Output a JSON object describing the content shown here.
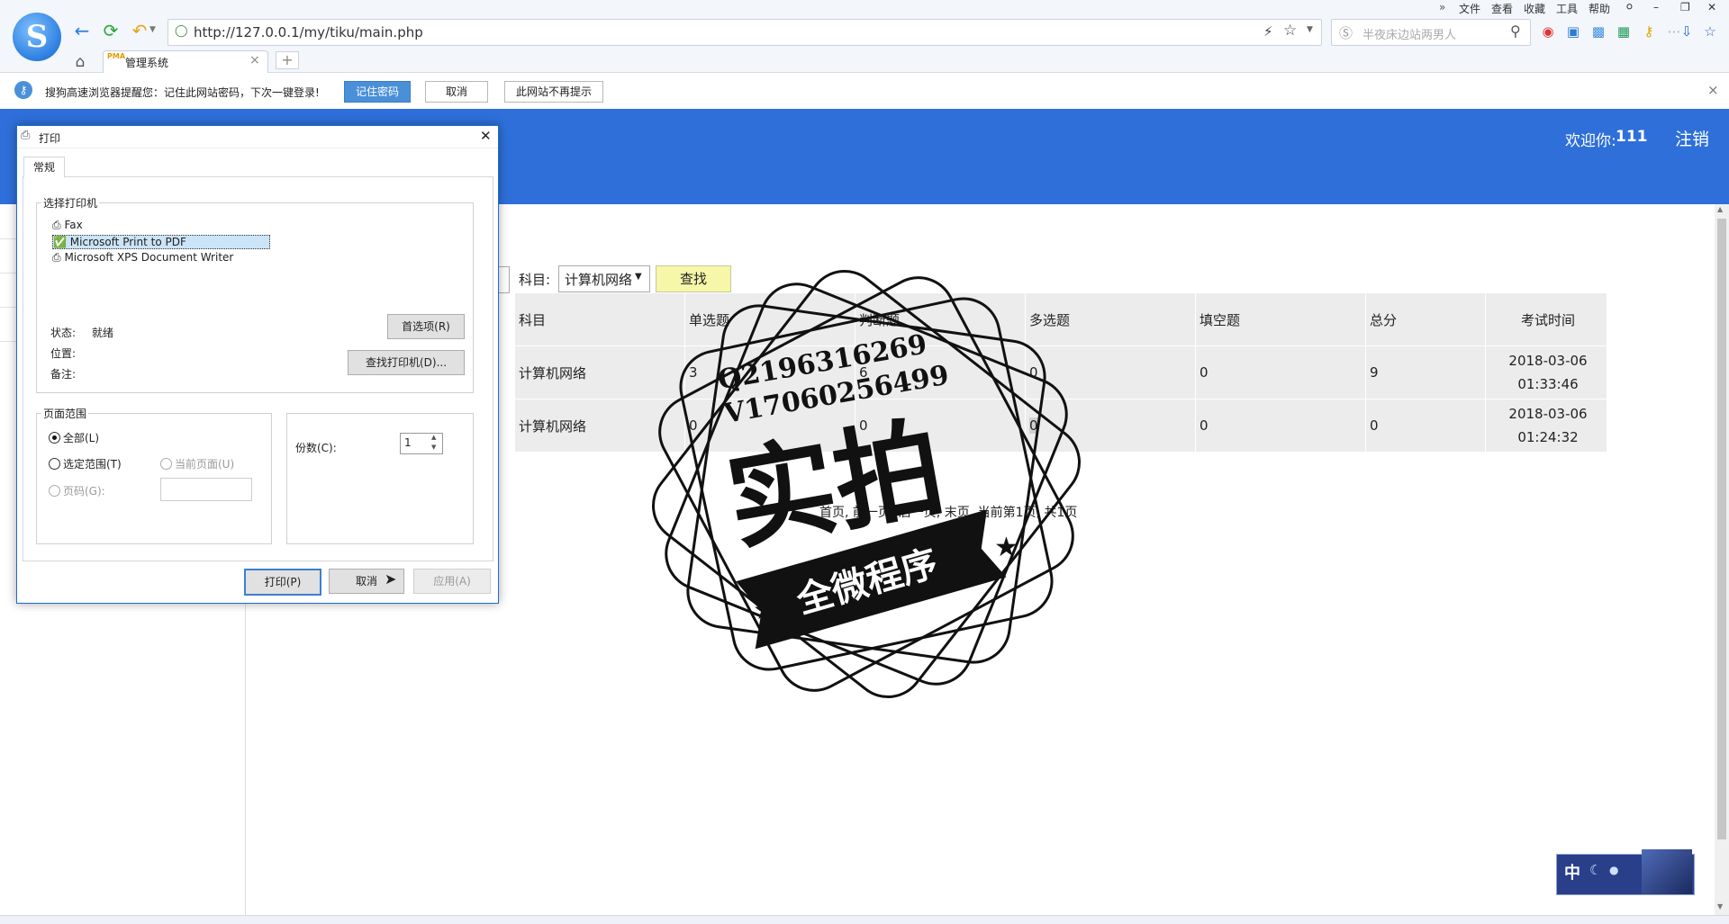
{
  "browser": {
    "url": "http://127.0.0.1/my/tiku/main.php",
    "search_placeholder": "半夜床边站两男人",
    "tab_title": "管理系统",
    "tab_icon_label": "PMA",
    "menu": [
      "文件",
      "查看",
      "收藏",
      "工具",
      "帮助"
    ]
  },
  "infobar": {
    "message": "搜狗高速浏览器提醒您：记住此网站密码，下次一键登录!",
    "remember_label": "记住密码",
    "cancel_label": "取消",
    "never_label": "此网站不再提示"
  },
  "header": {
    "welcome_prefix": "欢迎你:",
    "username": "111",
    "logout_label": "注销"
  },
  "filter": {
    "subject_label": "科目:",
    "subject_value": "计算机网络",
    "search_label": "查找"
  },
  "table": {
    "columns": [
      "科目",
      "单选题",
      "判断题",
      "多选题",
      "填空题",
      "总分",
      "考试时间"
    ],
    "rows": [
      {
        "subject": "计算机网络",
        "single": "3",
        "judge": "6",
        "multi": "0",
        "blank": "0",
        "total": "9",
        "date": "2018-03-06",
        "time": "01:33:46"
      },
      {
        "subject": "计算机网络",
        "single": "0",
        "judge": "0",
        "multi": "0",
        "blank": "0",
        "total": "0",
        "date": "2018-03-06",
        "time": "01:24:32"
      }
    ]
  },
  "pagination": "首页, 前一页, 后一页, 末页, 当前第1页, 共1页",
  "print_dialog": {
    "title": "打印",
    "tab": "常规",
    "printer_group": "选择打印机",
    "printers": [
      "Fax",
      "Microsoft Print to PDF",
      "Microsoft XPS Document Writer"
    ],
    "status_label": "状态:",
    "status_value": "就绪",
    "location_label": "位置:",
    "comment_label": "备注:",
    "preferences_label": "首选项(R)",
    "find_printer_label": "查找打印机(D)...",
    "range_group": "页面范围",
    "range_all": "全部(L)",
    "range_selection": "选定范围(T)",
    "range_current": "当前页面(U)",
    "range_pages": "页码(G):",
    "copies_label": "份数(C):",
    "copies_value": "1",
    "print_label": "打印(P)",
    "cancel_label": "取消",
    "apply_label": "应用(A)"
  },
  "stamp": {
    "contact_q": "Q2196316269",
    "contact_v": "V17060256499",
    "big_text": "实拍",
    "banner_text": "全微程序"
  },
  "ime": {
    "mode": "中"
  }
}
